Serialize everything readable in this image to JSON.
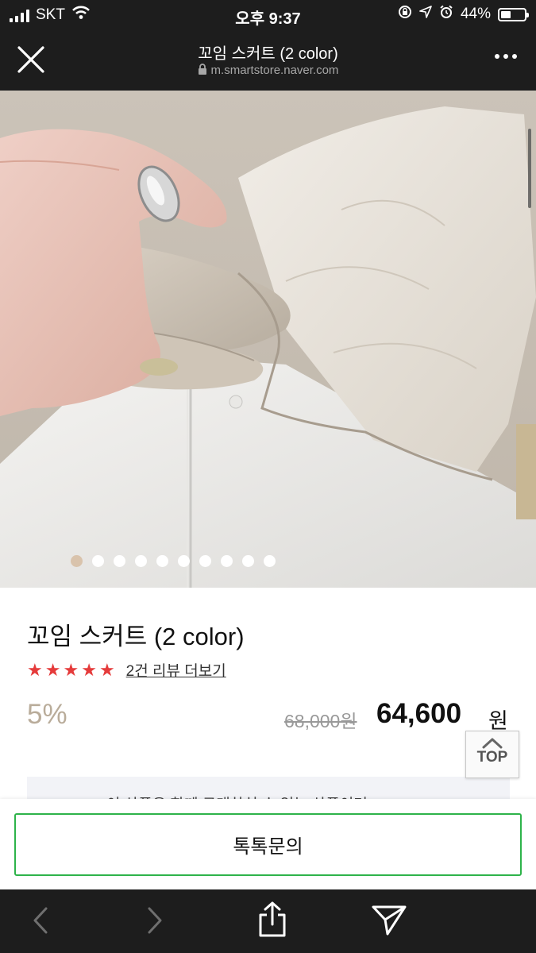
{
  "status_bar": {
    "carrier": "SKT",
    "time": "오후 9:37",
    "battery_percent": "44%",
    "battery_level": 0.44,
    "icons": [
      "signal-icon",
      "wifi-icon",
      "rotation-lock-icon",
      "location-icon",
      "alarm-icon",
      "battery-icon"
    ]
  },
  "header": {
    "title": "꼬임 스커트 (2 color)",
    "url": "m.smartstore.naver.com",
    "icons": [
      "close-icon",
      "lock-icon",
      "more-icon"
    ]
  },
  "gallery": {
    "total_images": 10,
    "current_index": 1
  },
  "product": {
    "title": "꼬임 스커트 (2 color)",
    "rating_stars": 5,
    "review_link": "2건 리뷰 더보기",
    "discount": "5%",
    "original_price": "68,000원",
    "sale_price": "64,600",
    "sale_unit": "원"
  },
  "top_button": {
    "label": "TOP"
  },
  "notice": {
    "text": "이 상품은 함께 구매하실 수 있는 상품이며"
  },
  "talk_button": {
    "label": "톡톡문의"
  },
  "toolbar": {
    "icons": [
      "back-icon",
      "forward-icon",
      "share-icon",
      "send-icon"
    ]
  },
  "colors": {
    "status_bg": "#1d1d1d",
    "star": "#e53b3b",
    "discount": "#b9ac9a",
    "talk_border": "#2eb34a"
  }
}
